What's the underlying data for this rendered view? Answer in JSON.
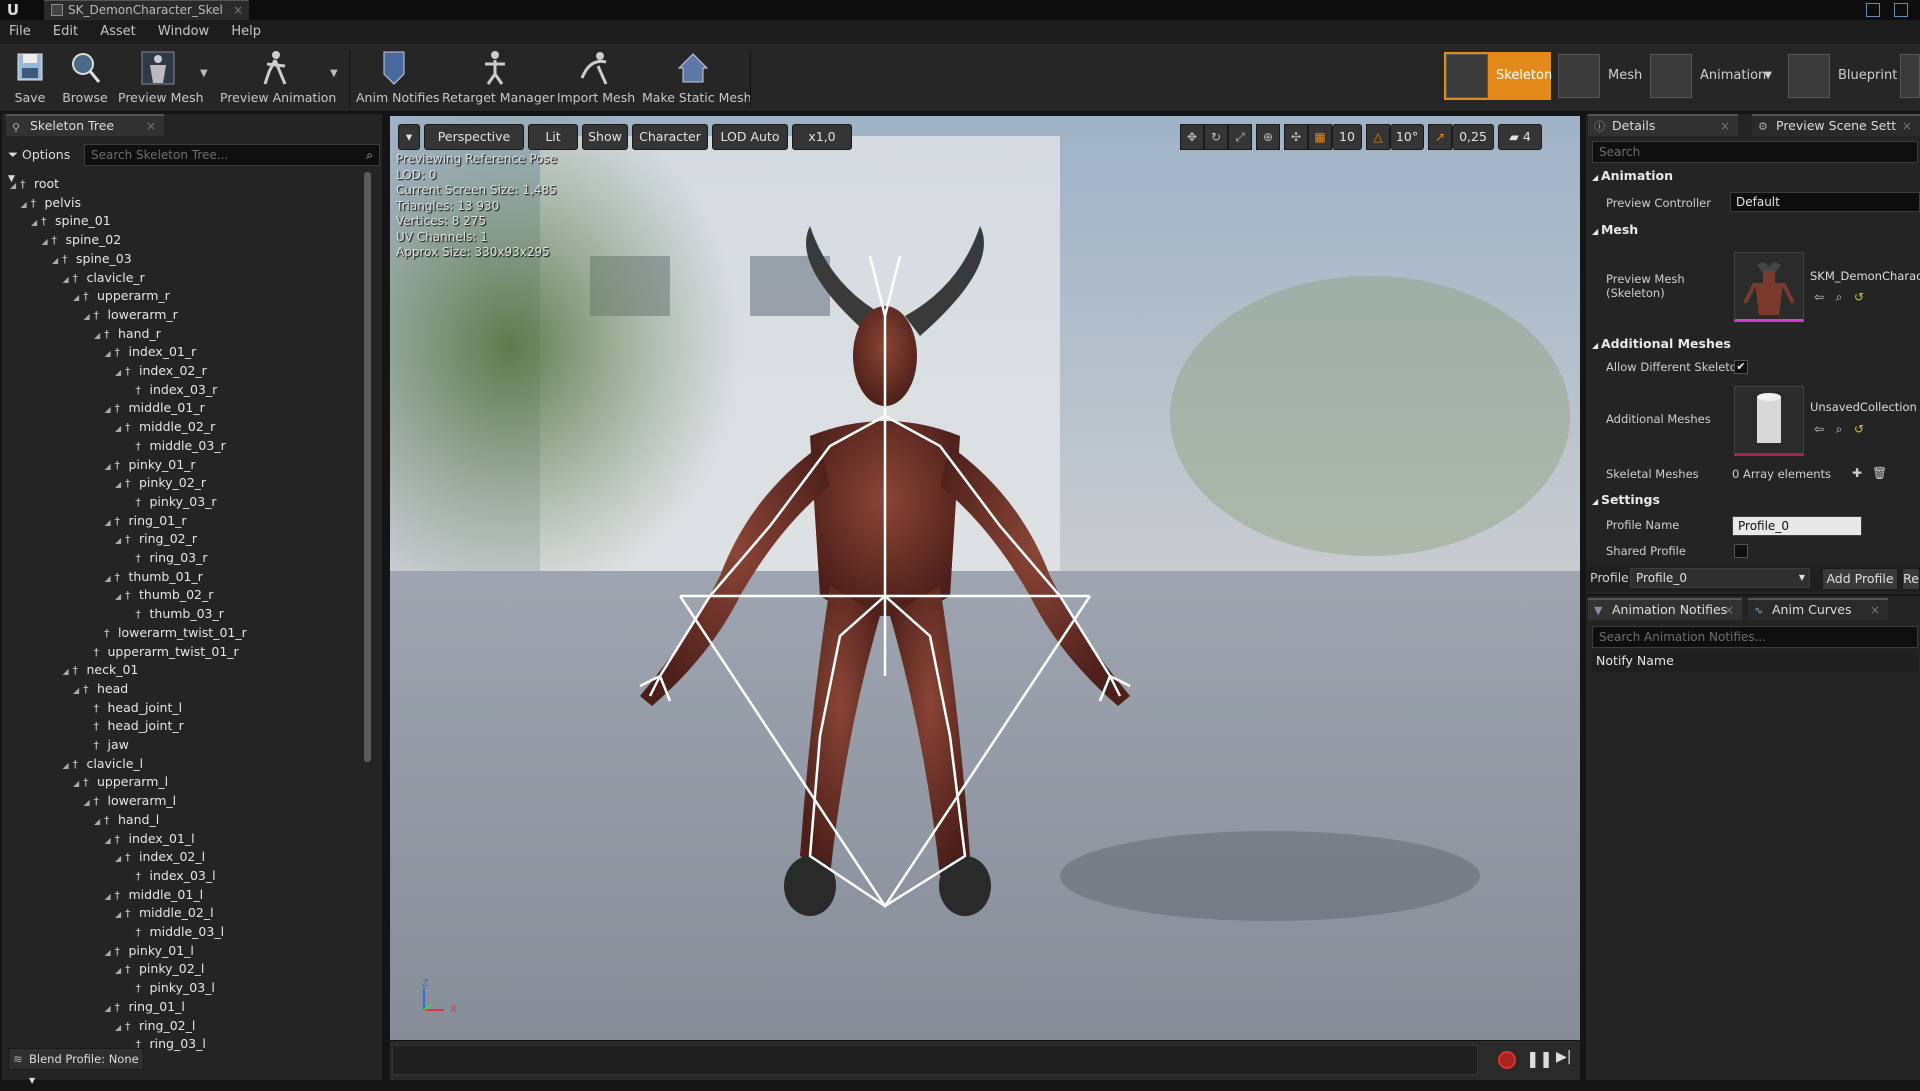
{
  "window": {
    "tab_title": "SK_DemonCharacter_Skel"
  },
  "menu": [
    "File",
    "Edit",
    "Asset",
    "Window",
    "Help"
  ],
  "toolbar": {
    "save": "Save",
    "browse": "Browse",
    "preview_mesh": "Preview Mesh",
    "preview_animation": "Preview Animation",
    "anim_notifies": "Anim Notifies",
    "retarget_manager": "Retarget Manager",
    "import_mesh": "Import Mesh",
    "make_static_mesh": "Make Static Mesh"
  },
  "modes": {
    "skeleton": "Skeleton",
    "mesh": "Mesh",
    "animation": "Animation",
    "blueprint": "Blueprint"
  },
  "skeleton_tree": {
    "tab": "Skeleton Tree",
    "options": "Options",
    "search_placeholder": "Search Skeleton Tree...",
    "bones": [
      {
        "name": "root",
        "d": 0
      },
      {
        "name": "pelvis",
        "d": 1
      },
      {
        "name": "spine_01",
        "d": 2
      },
      {
        "name": "spine_02",
        "d": 3
      },
      {
        "name": "spine_03",
        "d": 4
      },
      {
        "name": "clavicle_r",
        "d": 5
      },
      {
        "name": "upperarm_r",
        "d": 6
      },
      {
        "name": "lowerarm_r",
        "d": 7
      },
      {
        "name": "hand_r",
        "d": 8
      },
      {
        "name": "index_01_r",
        "d": 9
      },
      {
        "name": "index_02_r",
        "d": 10
      },
      {
        "name": "index_03_r",
        "d": 11
      },
      {
        "name": "middle_01_r",
        "d": 9
      },
      {
        "name": "middle_02_r",
        "d": 10
      },
      {
        "name": "middle_03_r",
        "d": 11
      },
      {
        "name": "pinky_01_r",
        "d": 9
      },
      {
        "name": "pinky_02_r",
        "d": 10
      },
      {
        "name": "pinky_03_r",
        "d": 11
      },
      {
        "name": "ring_01_r",
        "d": 9
      },
      {
        "name": "ring_02_r",
        "d": 10
      },
      {
        "name": "ring_03_r",
        "d": 11
      },
      {
        "name": "thumb_01_r",
        "d": 9
      },
      {
        "name": "thumb_02_r",
        "d": 10
      },
      {
        "name": "thumb_03_r",
        "d": 11
      },
      {
        "name": "lowerarm_twist_01_r",
        "d": 8
      },
      {
        "name": "upperarm_twist_01_r",
        "d": 7
      },
      {
        "name": "neck_01",
        "d": 5
      },
      {
        "name": "head",
        "d": 6
      },
      {
        "name": "head_joint_l",
        "d": 7
      },
      {
        "name": "head_joint_r",
        "d": 7
      },
      {
        "name": "jaw",
        "d": 7
      },
      {
        "name": "clavicle_l",
        "d": 5
      },
      {
        "name": "upperarm_l",
        "d": 6
      },
      {
        "name": "lowerarm_l",
        "d": 7
      },
      {
        "name": "hand_l",
        "d": 8
      },
      {
        "name": "index_01_l",
        "d": 9
      },
      {
        "name": "index_02_l",
        "d": 10
      },
      {
        "name": "index_03_l",
        "d": 11
      },
      {
        "name": "middle_01_l",
        "d": 9
      },
      {
        "name": "middle_02_l",
        "d": 10
      },
      {
        "name": "middle_03_l",
        "d": 11
      },
      {
        "name": "pinky_01_l",
        "d": 9
      },
      {
        "name": "pinky_02_l",
        "d": 10
      },
      {
        "name": "pinky_03_l",
        "d": 11
      },
      {
        "name": "ring_01_l",
        "d": 9
      },
      {
        "name": "ring_02_l",
        "d": 10
      },
      {
        "name": "ring_03_l",
        "d": 11
      }
    ],
    "blend_profile": "Blend Profile: None"
  },
  "viewport": {
    "perspective": "Perspective",
    "lit": "Lit",
    "show": "Show",
    "character": "Character",
    "lod": "LOD Auto",
    "speed": "x1,0",
    "grid": "10",
    "rot": "10°",
    "scale": "0,25",
    "cam_speed": "4",
    "info": [
      "Previewing Reference Pose",
      "LOD: 0",
      "Current Screen Size: 1,485",
      "Triangles: 13 930",
      "Vertices: 8 275",
      "UV Channels: 1",
      "Approx Size: 330x93x295"
    ],
    "axis_z": "Z",
    "axis_x": "X"
  },
  "details": {
    "tab": "Details",
    "tab2": "Preview Scene Sett",
    "search_placeholder": "Search",
    "animation_hdr": "Animation",
    "preview_controller_lbl": "Preview Controller",
    "preview_controller_val": "Default",
    "mesh_hdr": "Mesh",
    "preview_mesh_lbl": "Preview Mesh (Skeleton)",
    "preview_mesh_val": "SKM_DemonCharact",
    "additional_hdr": "Additional Meshes",
    "allow_diff_lbl": "Allow Different Skeleto",
    "additional_lbl": "Additional Meshes",
    "additional_val": "UnsavedCollection",
    "skeletal_lbl": "Skeletal Meshes",
    "skeletal_val": "0 Array elements",
    "settings_hdr": "Settings",
    "profile_name_lbl": "Profile Name",
    "profile_name_val": "Profile_0",
    "shared_lbl": "Shared Profile",
    "profile_lbl": "Profile",
    "profile_val": "Profile_0",
    "add_profile": "Add Profile",
    "re": "Re"
  },
  "notifies": {
    "tab": "Animation Notifies",
    "tab2": "Anim Curves",
    "search_placeholder": "Search Animation Notifies...",
    "col": "Notify Name"
  },
  "colors": {
    "accent": "#e38a1a",
    "bg": "#242424"
  }
}
